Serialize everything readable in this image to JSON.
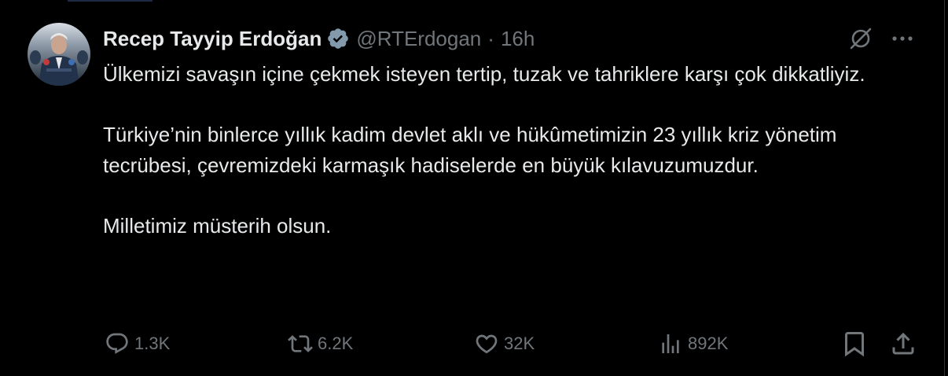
{
  "tweet": {
    "display_name": "Recep Tayyip Erdoğan",
    "handle": "@RTErdogan",
    "separator": "·",
    "time": "16h",
    "paragraphs": [
      "Ülkemizi savaşın içine çekmek isteyen tertip, tuzak ve tahriklere karşı çok dikkatliyiz.",
      "Türkiye’nin binlerce yıllık kadim devlet aklı ve hükûmetimizin 23 yıllık kriz yönetim tecrübesi, çevremizdeki karmaşık hadiselerde en büyük kılavuzumuzdur.",
      "Milletimiz müsterih olsun."
    ]
  },
  "actions": {
    "replies": "1.3K",
    "reposts": "6.2K",
    "likes": "32K",
    "views": "892K"
  },
  "icons": {
    "verified": "verified-badge-icon",
    "grok": "grok-icon",
    "more": "more-icon",
    "reply": "reply-icon",
    "repost": "repost-icon",
    "like": "heart-icon",
    "views": "views-icon",
    "bookmark": "bookmark-icon",
    "share": "share-icon"
  },
  "colors": {
    "background": "#000000",
    "text": "#e7e9ea",
    "muted": "#71767b",
    "verified_badge": "#829aab"
  }
}
